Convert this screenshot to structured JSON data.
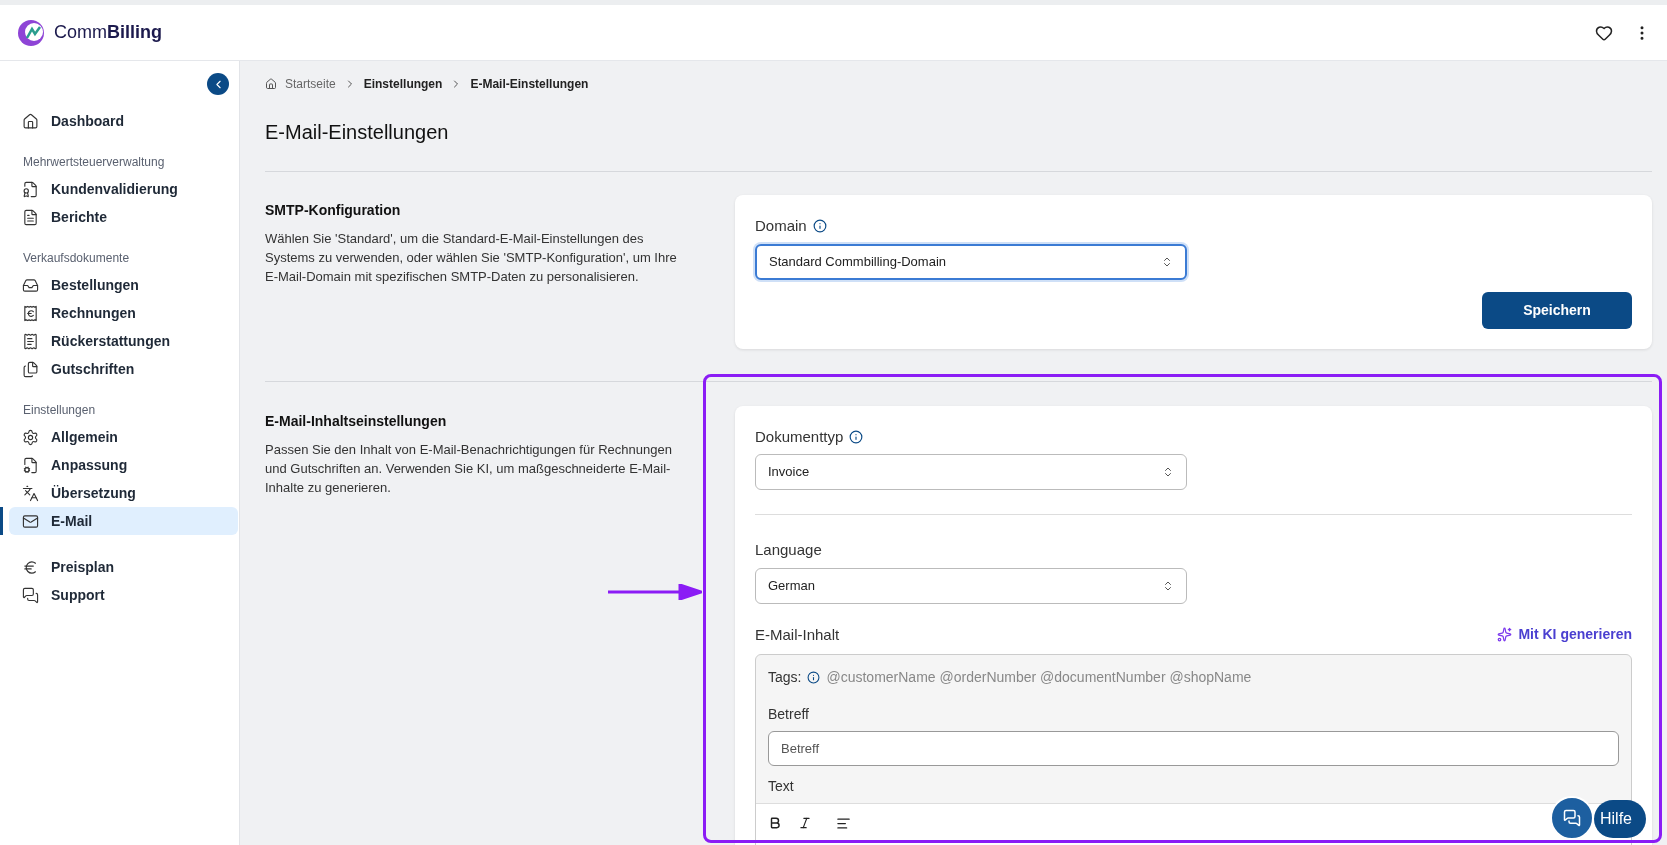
{
  "header": {
    "logo": "Comm**Billing**"
  },
  "sidebar": {
    "groups": [
      {
        "items": [
          {
            "kind": "home",
            "label": "Dashboard",
            "selected": false
          }
        ]
      },
      {
        "heading": "Mehrwertsteuerverwaltung",
        "items": [
          {
            "kind": "receipt-percent",
            "label": "Kundenvalidierung",
            "selected": false
          },
          {
            "kind": "file",
            "label": "Berichte",
            "selected": false
          }
        ]
      },
      {
        "heading": "Verkaufsdokumente",
        "items": [
          {
            "kind": "inbox",
            "label": "Bestellungen",
            "selected": false
          },
          {
            "kind": "receipt-euro",
            "label": "Rechnungen",
            "selected": false
          },
          {
            "kind": "receipt-undo",
            "label": "Rückerstattungen",
            "selected": false
          },
          {
            "kind": "copy",
            "label": "Gutschriften",
            "selected": false
          }
        ]
      },
      {
        "heading": "Einstellungen",
        "items": [
          {
            "kind": "gear",
            "label": "Allgemein",
            "selected": false
          },
          {
            "kind": "file-gear",
            "label": "Anpassung",
            "selected": false
          },
          {
            "kind": "translate",
            "label": "Übersetzung",
            "selected": false
          },
          {
            "kind": "mail-gear",
            "label": "E-Mail",
            "selected": true
          }
        ]
      },
      {
        "items": [
          {
            "kind": "euro",
            "label": "Preisplan",
            "selected": false
          },
          {
            "kind": "chat",
            "label": "Support",
            "selected": false
          }
        ]
      }
    ]
  },
  "breadcrumb": [
    "Startseite",
    "Einstellungen",
    "E-Mail-Einstellungen"
  ],
  "page_title": "E-Mail-Einstellungen",
  "smtp": {
    "title": "SMTP-Konfiguration",
    "description": "Wählen Sie 'Standard', um die Standard-E-Mail-Einstellungen des Systems zu verwenden, oder wählen Sie 'SMTP-Konfiguration', um Ihre E-Mail-Domain mit spezifischen SMTP-Daten zu personalisieren.",
    "domain_label": "Domain",
    "domain_value": "Standard Commbilling-Domain",
    "save_button": "Speichern"
  },
  "content": {
    "title": "E-Mail-Inhaltseinstellungen",
    "description": "Passen Sie den Inhalt von E-Mail-Benachrichtigungen für Rechnungen und Gutschriften an. Verwenden Sie KI, um maßgeschneiderte E-Mail-Inhalte zu generieren.",
    "doctype_label": "Dokumenttyp",
    "doctype_value": "Invoice",
    "language_label": "Language",
    "language_value": "German",
    "email_content_label": "E-Mail-Inhalt",
    "ai_button": "Mit KI generieren",
    "tags_label": "Tags:",
    "tags": "@customerName @orderNumber @documentNumber @shopName",
    "subject_label": "Betreff",
    "subject_placeholder": "Betreff",
    "text_label": "Text"
  },
  "help_button": "Hilfe"
}
